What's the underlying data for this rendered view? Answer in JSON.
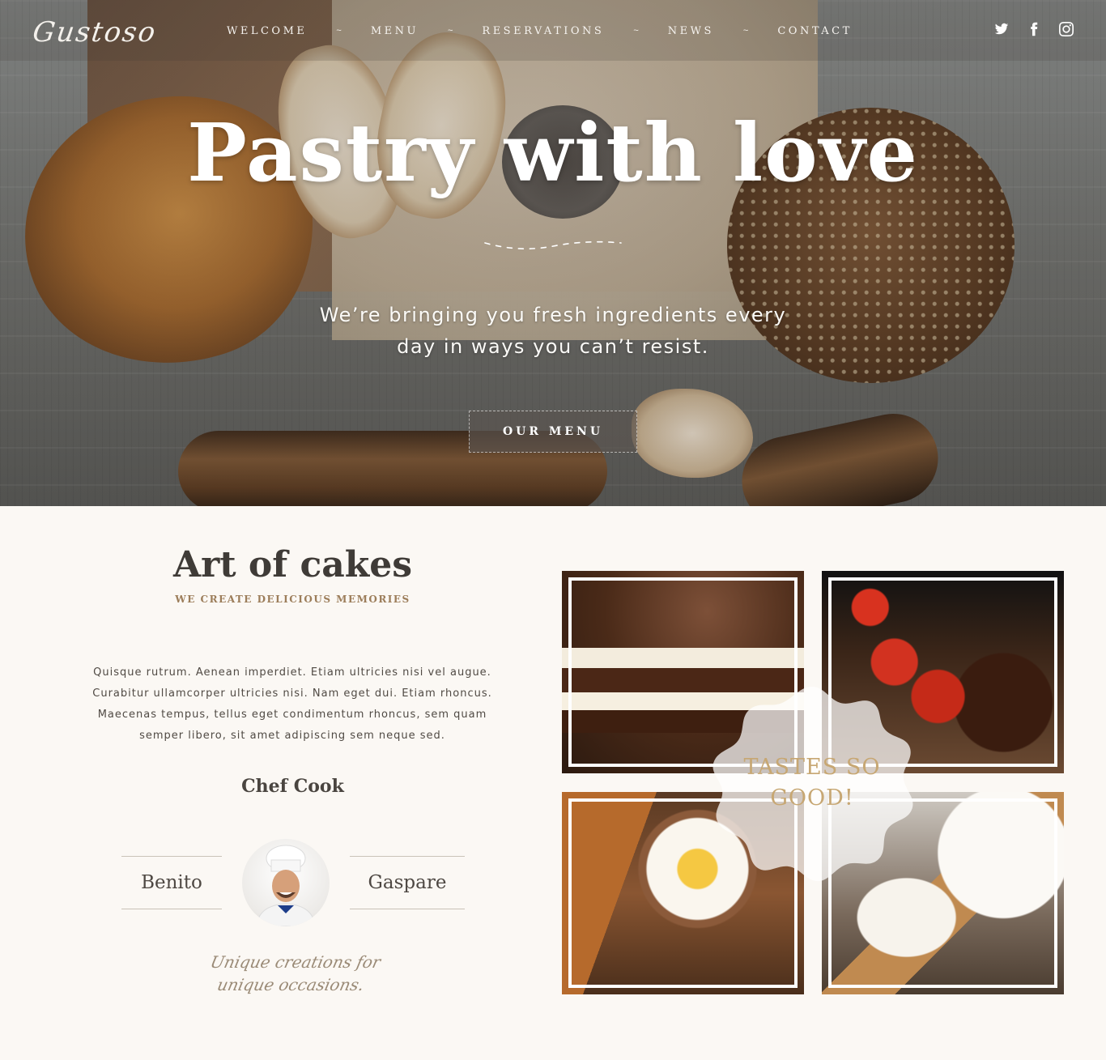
{
  "brand": {
    "logo_text": "Gustoso"
  },
  "nav": {
    "items": [
      "WELCOME",
      "MENU",
      "RESERVATIONS",
      "NEWS",
      "CONTACT"
    ],
    "separator": "~"
  },
  "social": [
    {
      "icon": "twitter-icon"
    },
    {
      "icon": "facebook-icon"
    },
    {
      "icon": "instagram-icon"
    }
  ],
  "hero": {
    "title": "Pastry with love",
    "subtitle": "We’re bringing you fresh ingredients every day in ways you can’t resist.",
    "button_label": "OUR MENU"
  },
  "about": {
    "title": "Art of cakes",
    "kicker": "WE CREATE DELICIOUS MEMORIES",
    "body": "Quisque rutrum. Aenean imperdiet. Etiam ultricies nisi vel augue. Curabitur ullamcorper ultricies nisi. Nam eget dui. Etiam rhoncus. Maecenas tempus, tellus eget condimentum rhoncus, sem quam semper libero, sit amet adipiscing sem neque sed.",
    "chef_title": "Chef Cook",
    "chef_first_name": "Benito",
    "chef_last_name": "Gaspare",
    "signature": "Unique creations for unique occasions."
  },
  "gallery": {
    "badge_text": "TASTES SO GOOD!",
    "images": [
      "chocolate cake slice",
      "strawberries and brownies",
      "baking ingredients",
      "flour scoop"
    ]
  },
  "colors": {
    "accent_gold": "#c7a773",
    "kicker_brown": "#9c7d5a",
    "heading_dark": "#3f3b37",
    "page_background": "#fbf8f4"
  }
}
